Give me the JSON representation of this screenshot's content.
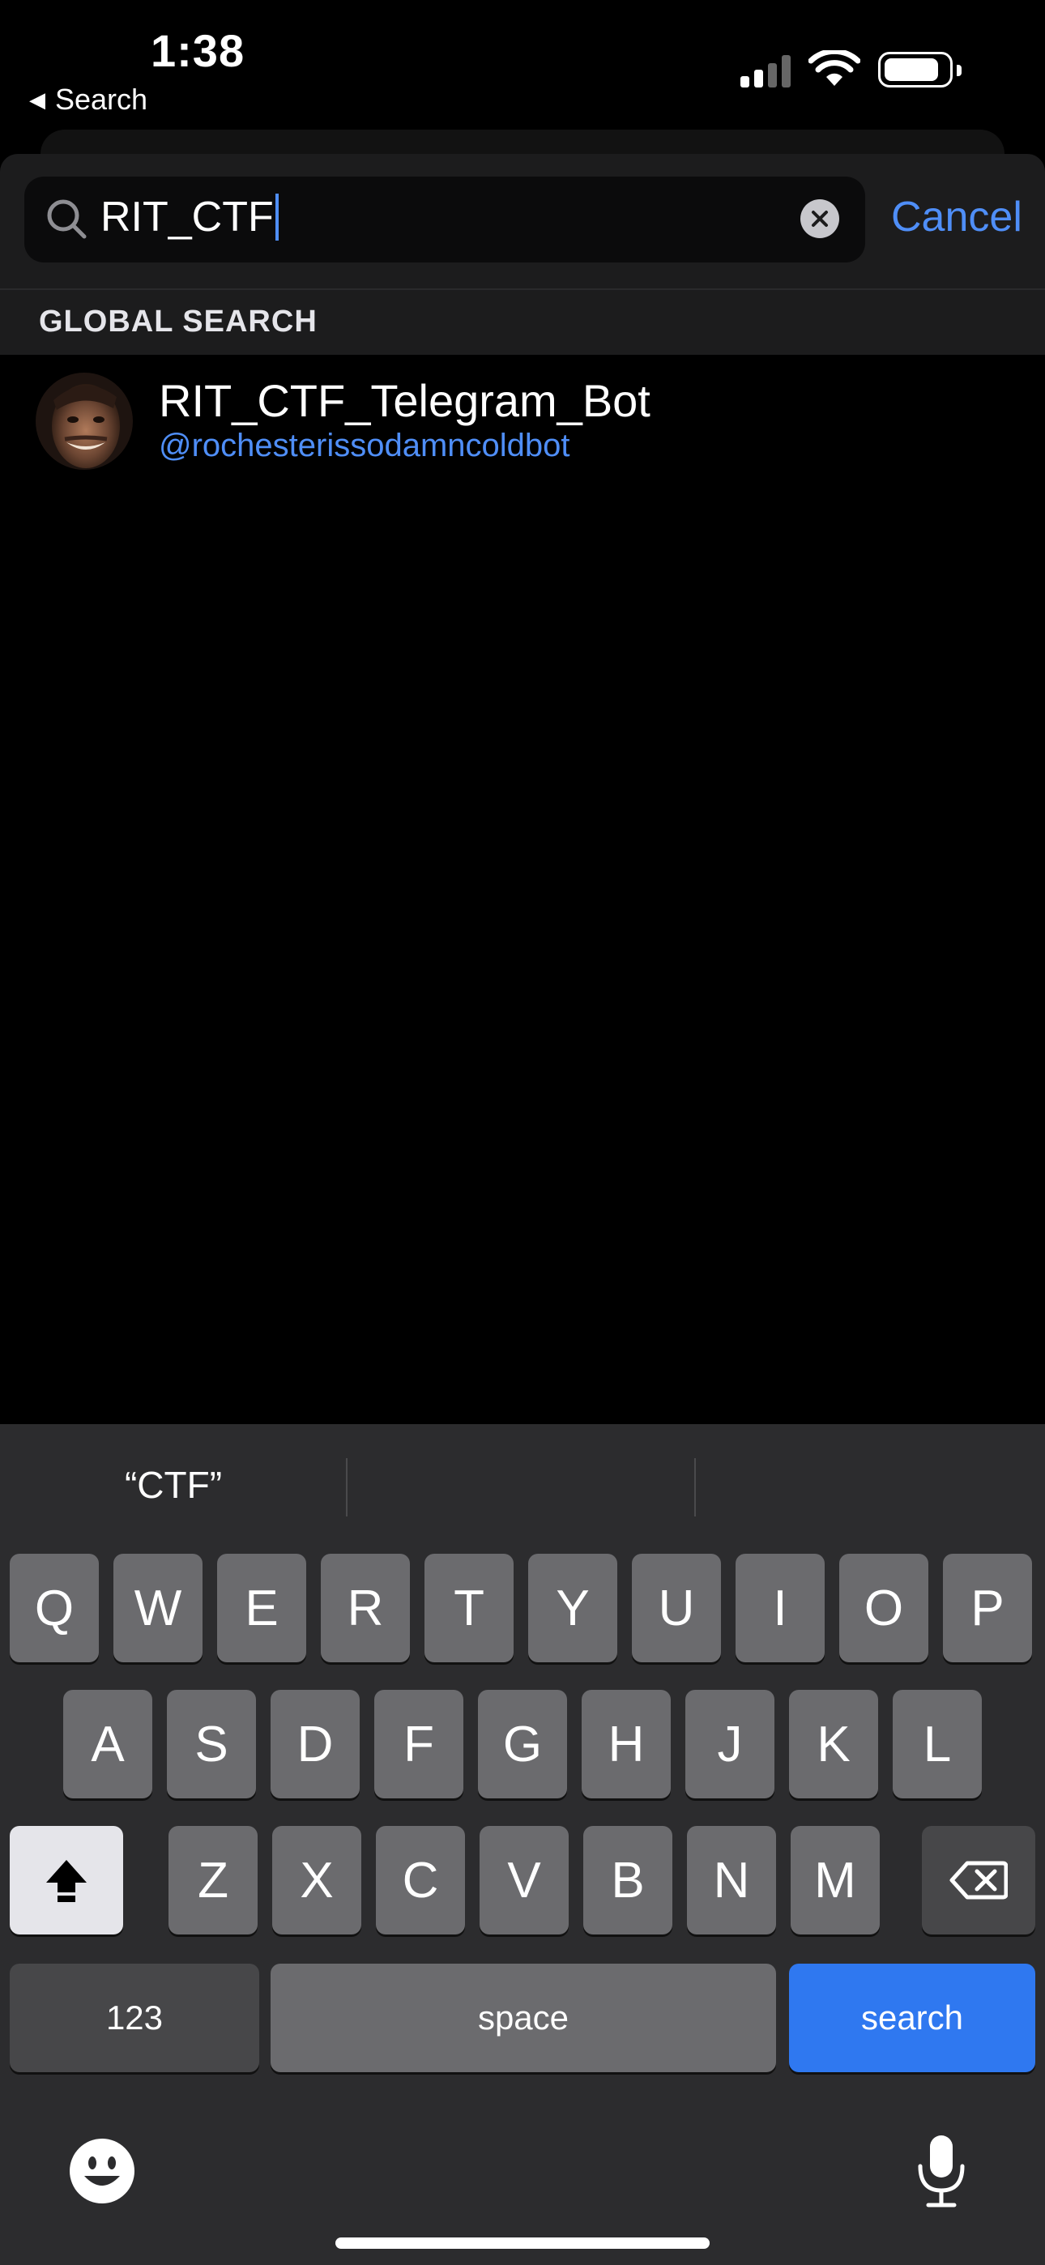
{
  "status_bar": {
    "time": "1:38",
    "back_label": "Search"
  },
  "search": {
    "query": "RIT_CTF",
    "cancel_label": "Cancel"
  },
  "section": {
    "title": "GLOBAL SEARCH"
  },
  "results": [
    {
      "name": "RIT_CTF_Telegram_Bot",
      "handle": "@rochesterissodamncoldbot"
    }
  ],
  "keyboard": {
    "suggestions": [
      "“CTF”",
      "",
      ""
    ],
    "row1": [
      "Q",
      "W",
      "E",
      "R",
      "T",
      "Y",
      "U",
      "I",
      "O",
      "P"
    ],
    "row2": [
      "A",
      "S",
      "D",
      "F",
      "G",
      "H",
      "J",
      "K",
      "L"
    ],
    "row3": [
      "Z",
      "X",
      "C",
      "V",
      "B",
      "N",
      "M"
    ],
    "numbers_label": "123",
    "space_label": "space",
    "action_label": "search"
  },
  "colors": {
    "accent": "#4f8ef7",
    "search_key": "#2f78f0",
    "keyboard_bg": "#2c2c2e"
  }
}
